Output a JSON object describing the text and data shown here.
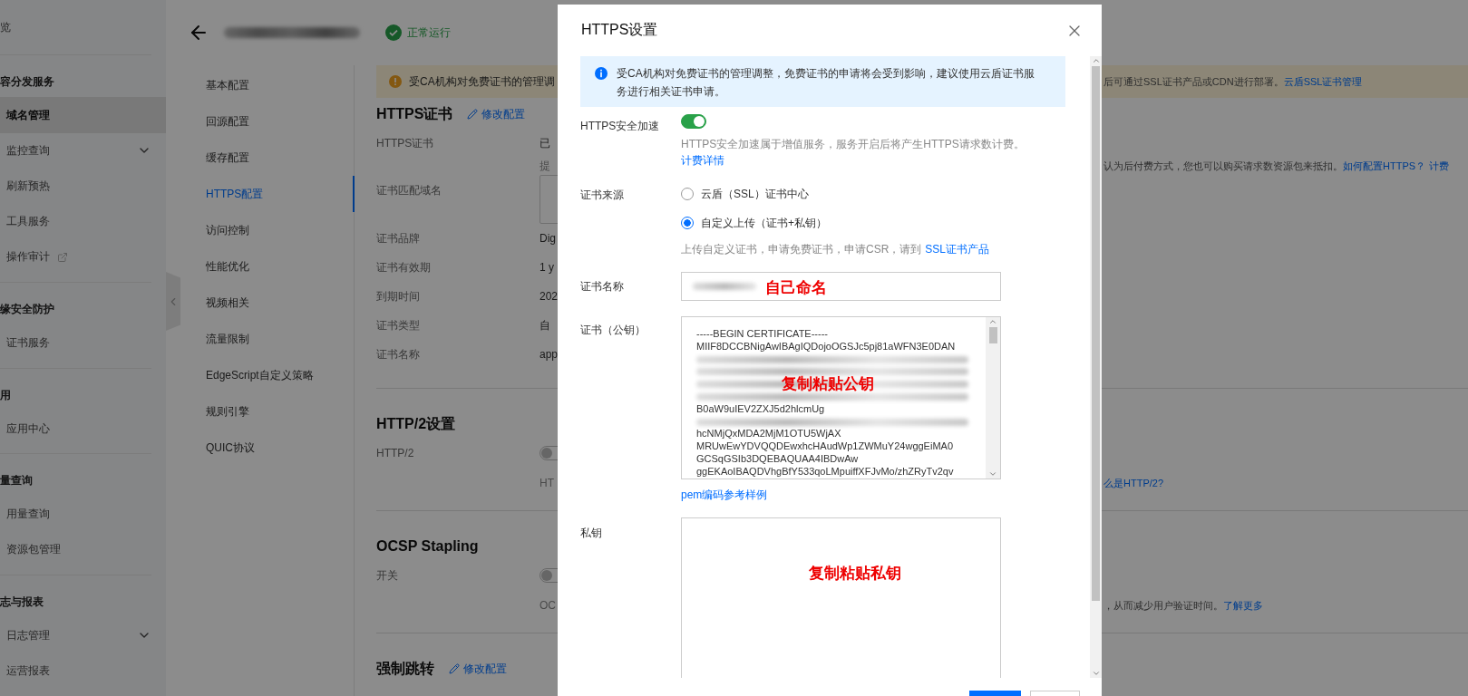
{
  "sidebar": {
    "top_item": {
      "label": "览"
    },
    "groups": [
      {
        "heading": "容分发服务",
        "items": [
          {
            "label": "域名管理",
            "kind": "plain",
            "selected": true
          },
          {
            "label": "监控查询",
            "kind": "submenu",
            "selected": false
          },
          {
            "label": "刷新预热",
            "kind": "plain",
            "selected": false
          },
          {
            "label": "工具服务",
            "kind": "plain",
            "selected": false
          },
          {
            "label": "操作审计",
            "kind": "external",
            "selected": false
          }
        ]
      },
      {
        "heading": "缘安全防护",
        "items": [
          {
            "label": "证书服务",
            "kind": "plain",
            "selected": false
          }
        ]
      },
      {
        "heading": "用",
        "items": [
          {
            "label": "应用中心",
            "kind": "plain",
            "selected": false
          }
        ]
      },
      {
        "heading": "量查询",
        "items": [
          {
            "label": "用量查询",
            "kind": "plain",
            "selected": false
          },
          {
            "label": "资源包管理",
            "kind": "plain",
            "selected": false
          }
        ]
      },
      {
        "heading": "志与报表",
        "items": [
          {
            "label": "日志管理",
            "kind": "submenu",
            "selected": false
          },
          {
            "label": "运营报表",
            "kind": "plain",
            "selected": false
          }
        ]
      }
    ]
  },
  "header": {
    "status": "正常运行"
  },
  "subnav": [
    {
      "label": "基本配置",
      "selected": false
    },
    {
      "label": "回源配置",
      "selected": false
    },
    {
      "label": "缓存配置",
      "selected": false
    },
    {
      "label": "HTTPS配置",
      "selected": true
    },
    {
      "label": "访问控制",
      "selected": false
    },
    {
      "label": "性能优化",
      "selected": false
    },
    {
      "label": "视频相关",
      "selected": false
    },
    {
      "label": "流量限制",
      "selected": false
    },
    {
      "label": "EdgeScript自定义策略",
      "selected": false
    },
    {
      "label": "规则引擎",
      "selected": false
    },
    {
      "label": "QUIC协议",
      "selected": false
    }
  ],
  "notice": {
    "text": "受CA机构对免费证书的管理调",
    "right_text": "后可通过SSL证书产品或CDN进行部署。",
    "right_link": "云盾SSL证书管理"
  },
  "sections": [
    {
      "title": "HTTPS证书",
      "edit_link": "修改配置",
      "rows": [
        {
          "kind": "field",
          "label": "HTTPS证书",
          "value": "已"
        },
        {
          "kind": "hint",
          "value": "提",
          "right_text": "认为后付费方式，您也可以购买请求数资源包来抵扣。",
          "right_links": [
            "如何配置HTTPS？",
            "计费"
          ]
        },
        {
          "kind": "box",
          "label": "证书匹配域名"
        },
        {
          "kind": "field",
          "label": "证书品牌",
          "value": "Dig"
        },
        {
          "kind": "field",
          "label": "证书有效期",
          "value": "1 y"
        },
        {
          "kind": "field",
          "label": "到期时间",
          "value": "202"
        },
        {
          "kind": "field",
          "label": "证书类型",
          "value": "自"
        },
        {
          "kind": "field",
          "label": "证书名称",
          "value": "app"
        }
      ]
    },
    {
      "title": "HTTP/2设置",
      "rows": [
        {
          "kind": "toggle",
          "label": "HTTP/2",
          "on": false
        },
        {
          "kind": "hint",
          "value": "HT",
          "right_links": [
            "么是HTTP/2?"
          ]
        }
      ]
    },
    {
      "title": "OCSP Stapling",
      "rows": [
        {
          "kind": "toggle",
          "label": "开关",
          "on": false
        },
        {
          "kind": "hint",
          "value": "OC",
          "right_text": "，从而减少用户验证时间。",
          "right_links": [
            "了解更多"
          ]
        }
      ]
    },
    {
      "title": "强制跳转",
      "edit_link": "修改配置"
    }
  ],
  "modal": {
    "title": "HTTPS设置",
    "notice": "受CA机构对免费证书的管理调整，免费证书的申请将会受到影响，建议使用云盾证书服务进行相关证书申请。",
    "acceleration": {
      "label": "HTTPS安全加速",
      "on": true,
      "description": "HTTPS安全加速属于增值服务，服务开启后将产生HTTPS请求数计费。",
      "link": "计费详情"
    },
    "source": {
      "label": "证书来源",
      "options": [
        {
          "label": "云盾（SSL）证书中心",
          "selected": false
        },
        {
          "label": "自定义上传（证书+私钥）",
          "selected": true
        }
      ],
      "hint": "上传自定义证书，申请免费证书，申请CSR，请到",
      "link": "SSL证书产品"
    },
    "cert_name": {
      "label": "证书名称",
      "annotation": "自己命名"
    },
    "certificate": {
      "label": "证书（公钥）",
      "annotation": "复制粘贴公钥",
      "example_link": "pem编码参考样例",
      "lines": [
        {
          "kind": "text",
          "text": "-----BEGIN CERTIFICATE-----"
        },
        {
          "kind": "text",
          "text": "MIIF8DCCBNigAwIBAgIQDojoOGSJc5pj81aWFN3E0DAN"
        },
        {
          "kind": "blurred"
        },
        {
          "kind": "blurred"
        },
        {
          "kind": "blurred"
        },
        {
          "kind": "blurred"
        },
        {
          "kind": "text",
          "text": "B0aW9uIEV2ZXJ5d2hlcmUg"
        },
        {
          "kind": "blurred"
        },
        {
          "kind": "text",
          "text": "hcNMjQxMDA2MjM1OTU5WjAX"
        },
        {
          "kind": "text",
          "text": "MRUwEwYDVQQDEwxhcHAudWp1ZWMuY24wggEiMA0"
        },
        {
          "kind": "text",
          "text": "GCSqGSIb3DQEBAQUAA4IBDwAw"
        },
        {
          "kind": "text",
          "text": "ggEKAoIBAQDVhgBfY533qoLMpuiffXFJvMo/zhZRyTv2qv"
        }
      ]
    },
    "private_key": {
      "label": "私钥",
      "annotation": "复制粘贴私钥"
    }
  }
}
